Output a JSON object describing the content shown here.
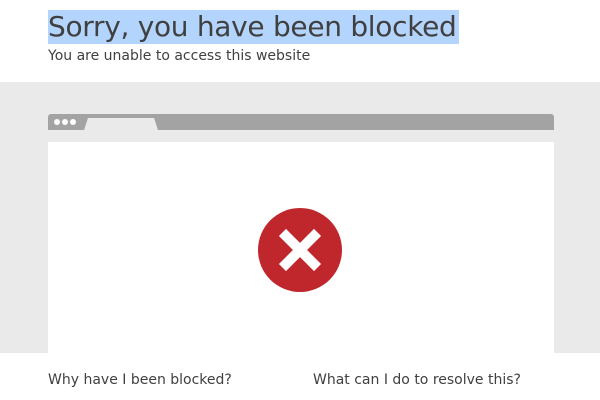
{
  "header": {
    "title": "Sorry, you have been blocked",
    "subtitle": "You are unable to access this website"
  },
  "illustration": {
    "status_icon": "blocked-x-icon",
    "status_color": "#c0272d"
  },
  "questions": {
    "why_blocked": "Why have I been blocked?",
    "resolve": "What can I do to resolve this?"
  }
}
